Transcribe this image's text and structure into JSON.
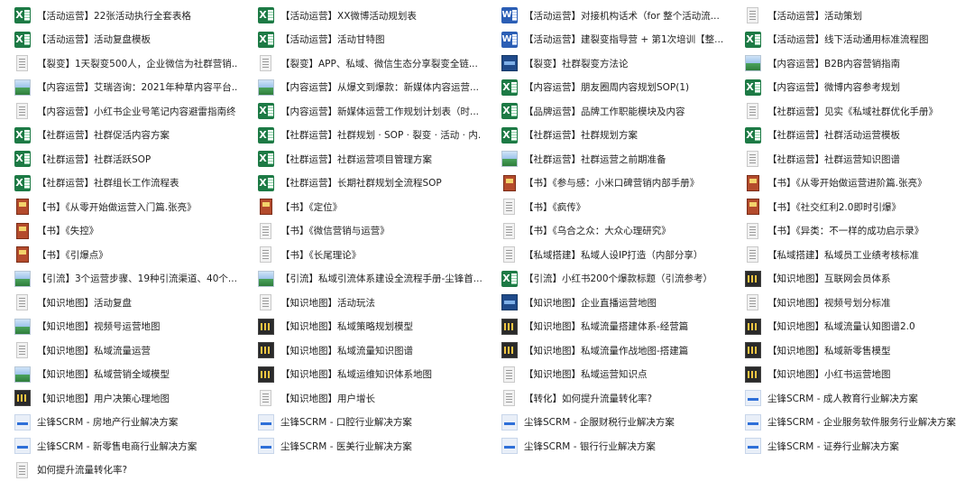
{
  "files": [
    {
      "label": "【活动运营】22张活动执行全套表格",
      "icon": "excel-icon"
    },
    {
      "label": "【活动运营】XX微博活动规划表",
      "icon": "excel-icon"
    },
    {
      "label": "【活动运营】对接机构话术（for 整个活动流...",
      "icon": "word-icon"
    },
    {
      "label": "【活动运营】活动策划",
      "icon": "document-icon"
    },
    {
      "label": "【活动运营】活动复盘模板",
      "icon": "excel-icon"
    },
    {
      "label": "【活动运营】活动甘特图",
      "icon": "excel-icon"
    },
    {
      "label": "【活动运营】建裂变指导营 + 第1次培训【整...",
      "icon": "word-icon"
    },
    {
      "label": "【活动运营】线下活动通用标准流程图",
      "icon": "excel-icon"
    },
    {
      "label": "【裂变】1天裂变500人，企业微信为社群营销...",
      "icon": "document-icon"
    },
    {
      "label": "【裂变】APP、私域、微信生态分享裂变全链...",
      "icon": "document-icon"
    },
    {
      "label": "【裂变】社群裂变方法论",
      "icon": "blue-image-icon"
    },
    {
      "label": "【内容运营】B2B内容营销指南",
      "icon": "image-icon"
    },
    {
      "label": "【内容运营】艾瑞咨询：2021年种草内容平台...",
      "icon": "image-icon"
    },
    {
      "label": "【内容运营】从爆文到爆款：新媒体内容运营...",
      "icon": "image-icon"
    },
    {
      "label": "【内容运营】朋友圈周内容规划SOP(1)",
      "icon": "excel-icon"
    },
    {
      "label": "【内容运营】微博内容参考规划",
      "icon": "excel-icon"
    },
    {
      "label": "【内容运营】小红书企业号笔记内容避雷指南终",
      "icon": "document-icon"
    },
    {
      "label": "【内容运营】新媒体运营工作规划计划表（时...",
      "icon": "excel-icon"
    },
    {
      "label": "【品牌运营】品牌工作职能模块及内容",
      "icon": "excel-icon"
    },
    {
      "label": "【社群运营】见实《私域社群优化手册》",
      "icon": "document-icon"
    },
    {
      "label": "【社群运营】社群促活内容方案",
      "icon": "excel-icon"
    },
    {
      "label": "【社群运营】社群规划 · SOP · 裂变 · 活动 · 内...",
      "icon": "excel-icon"
    },
    {
      "label": "【社群运营】社群规划方案",
      "icon": "excel-icon"
    },
    {
      "label": "【社群运营】社群活动运营模板",
      "icon": "excel-icon"
    },
    {
      "label": "【社群运营】社群活跃SOP",
      "icon": "excel-icon"
    },
    {
      "label": "【社群运营】社群运营项目管理方案",
      "icon": "excel-icon"
    },
    {
      "label": "【社群运营】社群运营之前期准备",
      "icon": "image-icon"
    },
    {
      "label": "【社群运营】社群运营知识图谱",
      "icon": "document-icon"
    },
    {
      "label": "【社群运营】社群组长工作流程表",
      "icon": "excel-icon"
    },
    {
      "label": "【社群运营】长期社群规划全流程SOP",
      "icon": "excel-icon"
    },
    {
      "label": "【书】《参与感：小米口碑营销内部手册》",
      "icon": "book-icon"
    },
    {
      "label": "【书】《从零开始做运营进阶篇.张亮》",
      "icon": "book-icon"
    },
    {
      "label": "【书】《从零开始做运营入门篇.张亮》",
      "icon": "book-icon"
    },
    {
      "label": "【书】《定位》",
      "icon": "book-icon"
    },
    {
      "label": "【书】《疯传》",
      "icon": "document-icon"
    },
    {
      "label": "【书】《社交红利2.0即时引爆》",
      "icon": "book-icon"
    },
    {
      "label": "【书】《失控》",
      "icon": "book-icon"
    },
    {
      "label": "【书】《微信营销与运营》",
      "icon": "document-icon"
    },
    {
      "label": "【书】《乌合之众：大众心理研究》",
      "icon": "document-icon"
    },
    {
      "label": "【书】《异类：不一样的成功启示录》",
      "icon": "document-icon"
    },
    {
      "label": "【书】《引爆点》",
      "icon": "book-icon"
    },
    {
      "label": "【书】《长尾理论》",
      "icon": "document-icon"
    },
    {
      "label": "【私域搭建】私域人设IP打造（内部分享）",
      "icon": "document-icon"
    },
    {
      "label": "【私域搭建】私域员工业绩考核标准",
      "icon": "document-icon"
    },
    {
      "label": "【引流】3个运营步骤、19种引流渠道、40个...",
      "icon": "image-icon"
    },
    {
      "label": "【引流】私域引流体系建设全流程手册-尘锋首...",
      "icon": "image-icon"
    },
    {
      "label": "【引流】小红书200个爆款标题（引流参考）",
      "icon": "excel-icon"
    },
    {
      "label": "【知识地图】互联网会员体系",
      "icon": "mindmap-icon"
    },
    {
      "label": "【知识地图】活动复盘",
      "icon": "document-icon"
    },
    {
      "label": "【知识地图】活动玩法",
      "icon": "document-icon"
    },
    {
      "label": "【知识地图】企业直播运营地图",
      "icon": "blue-image-icon"
    },
    {
      "label": "【知识地图】视频号划分标准",
      "icon": "document-icon"
    },
    {
      "label": "【知识地图】视频号运营地图",
      "icon": "image-icon"
    },
    {
      "label": "【知识地图】私域策略规划模型",
      "icon": "mindmap-icon"
    },
    {
      "label": "【知识地图】私域流量搭建体系-经营篇",
      "icon": "mindmap-icon"
    },
    {
      "label": "【知识地图】私域流量认知图谱2.0",
      "icon": "mindmap-icon"
    },
    {
      "label": "【知识地图】私域流量运营",
      "icon": "document-icon"
    },
    {
      "label": "【知识地图】私域流量知识图谱",
      "icon": "mindmap-icon"
    },
    {
      "label": "【知识地图】私域流量作战地图-搭建篇",
      "icon": "mindmap-icon"
    },
    {
      "label": "【知识地图】私域新零售模型",
      "icon": "mindmap-icon"
    },
    {
      "label": "【知识地图】私域营销全域模型",
      "icon": "image-icon"
    },
    {
      "label": "【知识地图】私域运维知识体系地图",
      "icon": "mindmap-icon"
    },
    {
      "label": "【知识地图】私域运营知识点",
      "icon": "document-icon"
    },
    {
      "label": "【知识地图】小红书运营地图",
      "icon": "mindmap-icon"
    },
    {
      "label": "【知识地图】用户决策心理地图",
      "icon": "mindmap-icon"
    },
    {
      "label": "【知识地图】用户增长",
      "icon": "document-icon"
    },
    {
      "label": "【转化】如何提升流量转化率?",
      "icon": "document-icon"
    },
    {
      "label": "尘锋SCRM - 成人教育行业解决方案",
      "icon": "scrm-slide-icon"
    },
    {
      "label": "尘锋SCRM - 房地产行业解决方案",
      "icon": "scrm-slide-icon"
    },
    {
      "label": "尘锋SCRM - 口腔行业解决方案",
      "icon": "scrm-slide-icon"
    },
    {
      "label": "尘锋SCRM - 企服财税行业解决方案",
      "icon": "scrm-slide-icon"
    },
    {
      "label": "尘锋SCRM - 企业服务软件服务行业解决方案",
      "icon": "scrm-slide-icon"
    },
    {
      "label": "尘锋SCRM - 新零售电商行业解决方案",
      "icon": "scrm-slide-icon"
    },
    {
      "label": "尘锋SCRM - 医美行业解决方案",
      "icon": "scrm-slide-icon"
    },
    {
      "label": "尘锋SCRM - 银行行业解决方案",
      "icon": "scrm-slide-icon"
    },
    {
      "label": "尘锋SCRM - 证券行业解决方案",
      "icon": "scrm-slide-icon"
    },
    {
      "label": "如何提升流量转化率?",
      "icon": "document-icon"
    }
  ]
}
